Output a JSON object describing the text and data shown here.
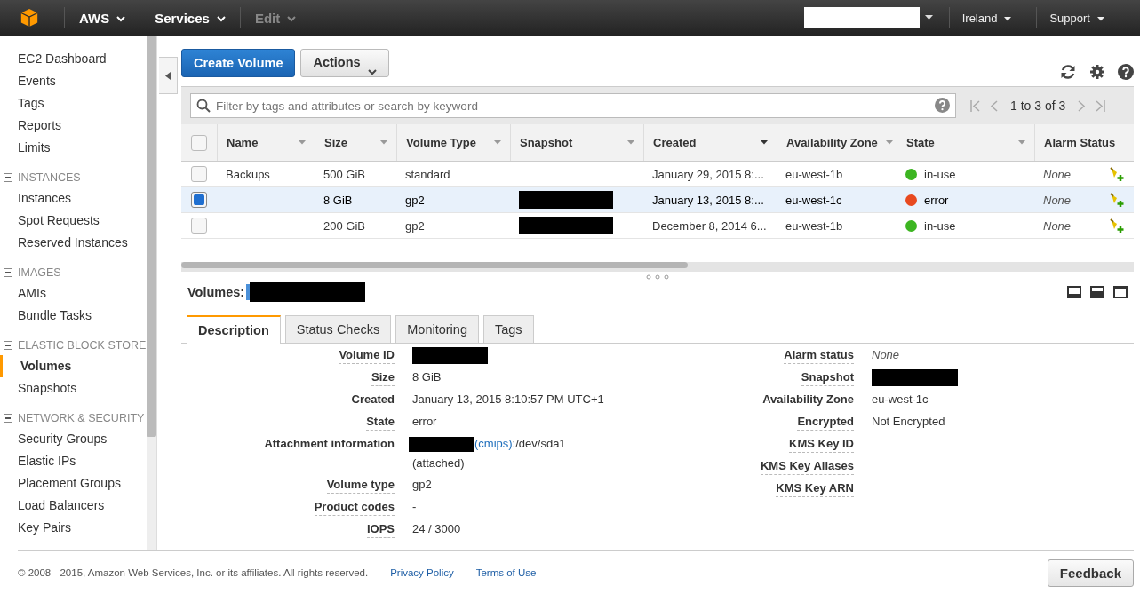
{
  "topbar": {
    "menus": [
      {
        "label": "AWS",
        "disabled": false
      },
      {
        "label": "Services",
        "disabled": false
      },
      {
        "label": "Edit",
        "disabled": true
      }
    ],
    "right_menus": [
      "Ireland",
      "Support"
    ]
  },
  "sidebar": {
    "sections": [
      {
        "items": [
          {
            "label": "EC2 Dashboard",
            "selected": false
          },
          {
            "label": "Events",
            "selected": false
          },
          {
            "label": "Tags",
            "selected": false
          },
          {
            "label": "Reports",
            "selected": false
          },
          {
            "label": "Limits",
            "selected": false
          }
        ]
      },
      {
        "title": "INSTANCES",
        "items": [
          {
            "label": "Instances",
            "selected": false
          },
          {
            "label": "Spot Requests",
            "selected": false
          },
          {
            "label": "Reserved Instances",
            "selected": false
          }
        ]
      },
      {
        "title": "IMAGES",
        "items": [
          {
            "label": "AMIs",
            "selected": false
          },
          {
            "label": "Bundle Tasks",
            "selected": false
          }
        ]
      },
      {
        "title": "ELASTIC BLOCK STORE",
        "items": [
          {
            "label": "Volumes",
            "selected": true
          },
          {
            "label": "Snapshots",
            "selected": false
          }
        ]
      },
      {
        "title": "NETWORK & SECURITY",
        "items": [
          {
            "label": "Security Groups",
            "selected": false
          },
          {
            "label": "Elastic IPs",
            "selected": false
          },
          {
            "label": "Placement Groups",
            "selected": false
          },
          {
            "label": "Load Balancers",
            "selected": false
          },
          {
            "label": "Key Pairs",
            "selected": false
          }
        ]
      }
    ]
  },
  "toolbar": {
    "primary_button": "Create Volume",
    "actions_button": "Actions"
  },
  "search": {
    "placeholder": "Filter by tags and attributes or search by keyword"
  },
  "pagination": "1 to 3 of 3",
  "table": {
    "all_checked": false,
    "columns": [
      "Name",
      "Size",
      "Volume Type",
      "Snapshot",
      "Created",
      "Availability Zone",
      "State",
      "Alarm Status"
    ],
    "rows": [
      {
        "selected": false,
        "checked": false,
        "name": "Backups",
        "size": "500 GiB",
        "type": "standard",
        "snapshot_hidden": false,
        "created": "January 29, 2015 8:...",
        "zone": "eu-west-1b",
        "state": "in-use",
        "color": "#3cb521",
        "alarm": "None"
      },
      {
        "selected": true,
        "checked": true,
        "name": "",
        "size": "8 GiB",
        "type": "gp2",
        "snapshot_hidden": true,
        "created": "January 13, 2015 8:...",
        "zone": "eu-west-1c",
        "state": "error",
        "color": "#e8491f",
        "alarm": "None"
      },
      {
        "selected": false,
        "checked": false,
        "name": "",
        "size": "200 GiB",
        "type": "gp2",
        "snapshot_hidden": true,
        "created": "December 8, 2014 6...",
        "zone": "eu-west-1b",
        "state": "in-use",
        "color": "#3cb521",
        "alarm": "None"
      }
    ]
  },
  "details": {
    "title": "Volumes:",
    "tabs": [
      {
        "label": "Description",
        "selected": true
      },
      {
        "label": "Status Checks",
        "selected": false
      },
      {
        "label": "Monitoring",
        "selected": false
      },
      {
        "label": "Tags",
        "selected": false
      }
    ],
    "left": [
      {
        "label": "Volume ID",
        "kind": "redacted"
      },
      {
        "label": "Size",
        "kind": "text",
        "value": "8 GiB"
      },
      {
        "label": "Created",
        "kind": "text",
        "value": "January 13, 2015 8:10:57 PM UTC+1"
      },
      {
        "label": "State",
        "kind": "text",
        "value": "error"
      },
      {
        "label": "Attachment information",
        "kind": "attachment",
        "link": "(cmips)",
        "value": ":/dev/sda1",
        "note": "(attached)"
      },
      {
        "label": "Volume type",
        "kind": "text",
        "value": "gp2"
      },
      {
        "label": "Product codes",
        "kind": "text",
        "value": "-"
      },
      {
        "label": "IOPS",
        "kind": "text",
        "value": "24 / 3000"
      }
    ],
    "right": [
      {
        "label": "Alarm status",
        "kind": "italic",
        "value": "None"
      },
      {
        "label": "Snapshot",
        "kind": "redacted"
      },
      {
        "label": "Availability Zone",
        "kind": "text",
        "value": "eu-west-1c"
      },
      {
        "label": "Encrypted",
        "kind": "text",
        "value": "Not Encrypted"
      },
      {
        "label": "KMS Key ID",
        "kind": "empty"
      },
      {
        "label": "KMS Key Aliases",
        "kind": "gap"
      },
      {
        "label": "KMS Key ARN",
        "kind": "empty"
      }
    ]
  },
  "footer": {
    "copyright": "© 2008 - 2015, Amazon Web Services, Inc. or its affiliates. All rights reserved.",
    "links": [
      "Privacy Policy",
      "Terms of Use"
    ],
    "feedback": "Feedback"
  }
}
